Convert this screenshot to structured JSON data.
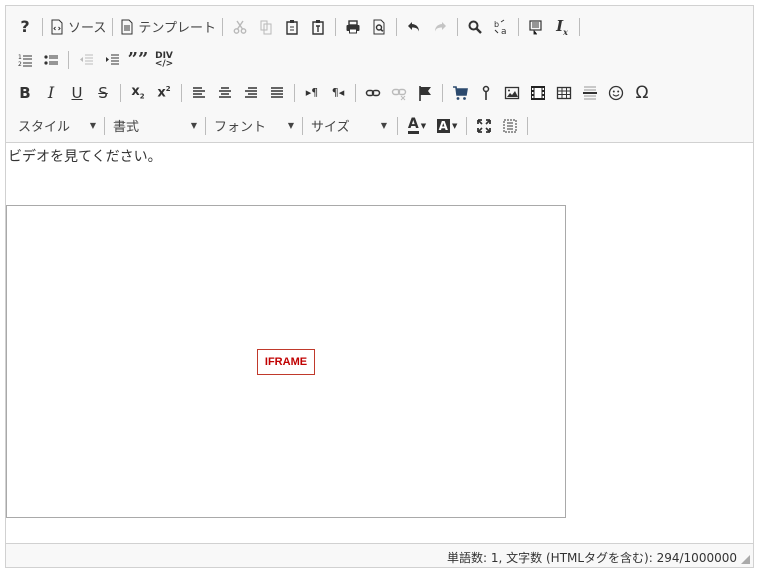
{
  "toolbar": {
    "source_label": "ソース",
    "template_label": "テンプレート",
    "combos": {
      "style": "スタイル",
      "format": "書式",
      "font": "フォント",
      "size": "サイズ"
    }
  },
  "content": {
    "paragraph": "ビデオを見てください。",
    "iframe_label": "IFRAME"
  },
  "status": {
    "count_text": "単語数: 1, 文字数 (HTMLタグを含む): 294/1000000"
  },
  "icons": [
    "help-icon",
    "source-icon",
    "templates-icon",
    "cut-icon",
    "copy-icon",
    "paste-icon",
    "paste-text-icon",
    "print-icon",
    "preview-icon",
    "undo-icon",
    "redo-icon",
    "find-icon",
    "replace-icon",
    "select-all-icon",
    "remove-format-icon",
    "numbered-list-icon",
    "bulleted-list-icon",
    "outdent-icon",
    "indent-icon",
    "blockquote-icon",
    "create-div-icon",
    "bold-icon",
    "italic-icon",
    "underline-icon",
    "strike-icon",
    "subscript-icon",
    "superscript-icon",
    "align-left-icon",
    "align-center-icon",
    "align-right-icon",
    "justify-icon",
    "ltr-icon",
    "rtl-icon",
    "link-icon",
    "unlink-icon",
    "anchor-icon",
    "cart-icon",
    "marker-icon",
    "image-icon",
    "video-icon",
    "table-icon",
    "horizontal-rule-icon",
    "smiley-icon",
    "special-char-icon",
    "text-color-icon",
    "bg-color-icon",
    "maximize-icon",
    "show-blocks-icon"
  ]
}
